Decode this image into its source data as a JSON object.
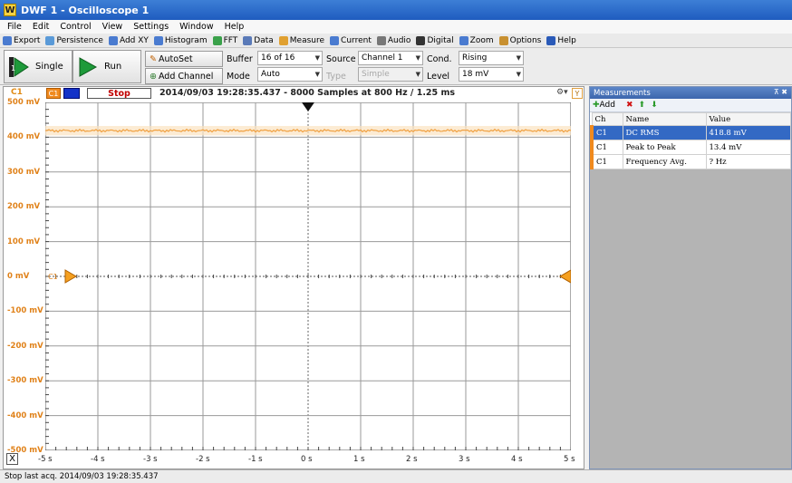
{
  "window": {
    "title": "DWF 1 - Oscilloscope 1",
    "icon_text": "W"
  },
  "menu": [
    "File",
    "Edit",
    "Control",
    "View",
    "Settings",
    "Window",
    "Help"
  ],
  "toolbar": [
    {
      "label": "Export",
      "icon": "export-icon",
      "color": "#4a7bd0"
    },
    {
      "label": "Persistence",
      "icon": "persistence-icon",
      "color": "#5a9ad8"
    },
    {
      "label": "Add XY",
      "icon": "add-xy-icon",
      "color": "#4a7bd0"
    },
    {
      "label": "Histogram",
      "icon": "histogram-icon",
      "color": "#4a7bd0"
    },
    {
      "label": "FFT",
      "icon": "fft-icon",
      "color": "#3aa14a"
    },
    {
      "label": "Data",
      "icon": "data-icon",
      "color": "#5a7ab8"
    },
    {
      "label": "Measure",
      "icon": "measure-icon",
      "color": "#e0a030"
    },
    {
      "label": "Current",
      "icon": "current-icon",
      "color": "#4a7bd0"
    },
    {
      "label": "Audio",
      "icon": "audio-icon",
      "color": "#777777"
    },
    {
      "label": "Digital",
      "icon": "digital-icon",
      "color": "#333333"
    },
    {
      "label": "Zoom",
      "icon": "zoom-icon",
      "color": "#4a7bd0"
    },
    {
      "label": "Options",
      "icon": "options-icon",
      "color": "#c89030"
    },
    {
      "label": "Help",
      "icon": "help-icon",
      "color": "#2a5ab8"
    }
  ],
  "controls": {
    "single": "Single",
    "run": "Run",
    "autoset": "AutoSet",
    "add_channel": "Add Channel",
    "buffer_label": "Buffer",
    "buffer_value": "16 of 16",
    "mode_label": "Mode",
    "mode_value": "Auto",
    "source_label": "Source",
    "source_value": "Channel 1",
    "type_label": "Type",
    "type_value": "Simple",
    "cond_label": "Cond.",
    "cond_value": "Rising",
    "level_label": "Level",
    "level_value": "18 mV"
  },
  "scope": {
    "channel_label": "C1",
    "channel_chip": "C1",
    "state": "Stop",
    "acq_info": "2014/09/03  19:28:35.437 - 8000 Samples at 800 Hz / 1.25 ms",
    "y_button": "Y",
    "x_button": "X",
    "marker_label": "C1",
    "trace_color": "#f0a040",
    "y_ticks": [
      "500 mV",
      "400 mV",
      "300 mV",
      "200 mV",
      "100 mV",
      "0 mV",
      "-100 mV",
      "-200 mV",
      "-300 mV",
      "-400 mV",
      "-500 mV"
    ],
    "x_ticks": [
      "-5 s",
      "-4 s",
      "-3 s",
      "-2 s",
      "-1 s",
      "0 s",
      "1 s",
      "2 s",
      "3 s",
      "4 s",
      "5 s"
    ],
    "trace_level_mv": 418.8,
    "trace_noise_mv": 13.4
  },
  "measurements": {
    "title": "Measurements",
    "add": "Add",
    "columns": [
      "Ch",
      "Name",
      "Value"
    ],
    "rows": [
      {
        "ch": "C1",
        "name": "DC RMS",
        "value": "418.8 mV"
      },
      {
        "ch": "C1",
        "name": "Peak to Peak",
        "value": "13.4 mV"
      },
      {
        "ch": "C1",
        "name": "Frequency Avg.",
        "value": "? Hz"
      }
    ]
  },
  "status": "Stop last acq. 2014/09/03  19:28:35.437"
}
